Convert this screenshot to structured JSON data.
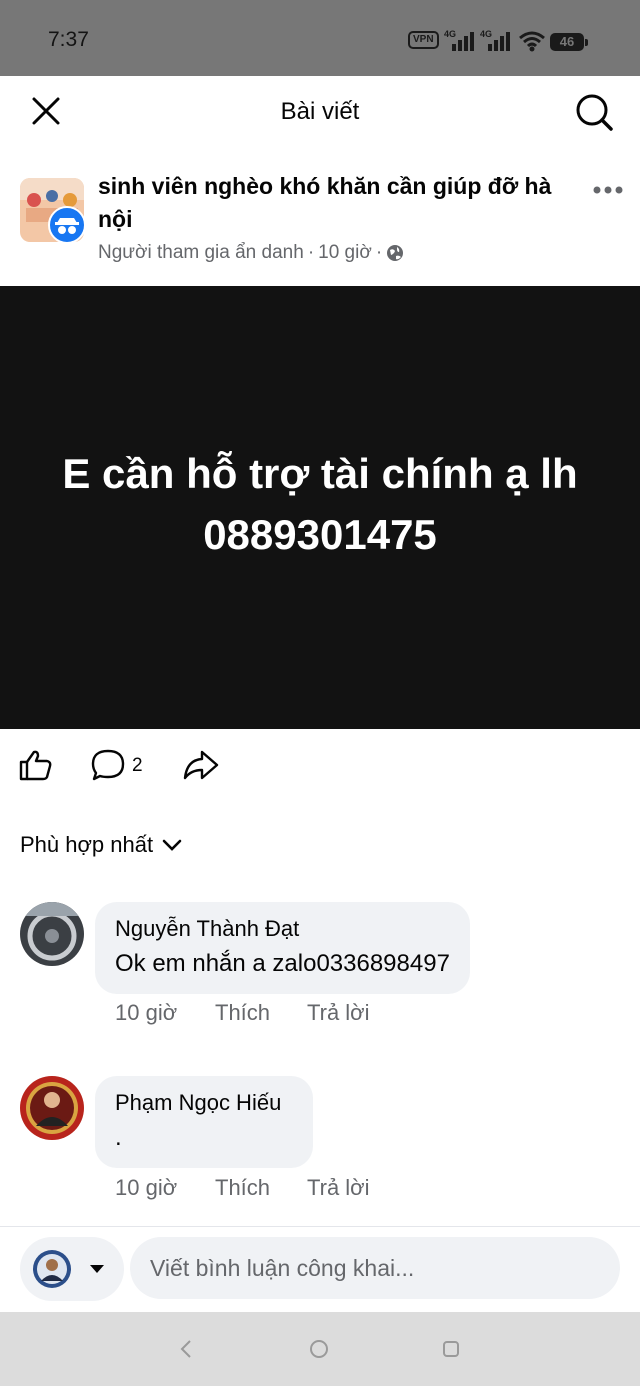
{
  "status_bar": {
    "time": "7:37",
    "vpn": "VPN",
    "network": "4G",
    "battery": "46"
  },
  "header": {
    "title": "Bài viết"
  },
  "post": {
    "group_name": "sinh viên nghèo khó khăn cần giúp đỡ hà nội",
    "author": "Người tham gia ẩn danh",
    "time": "10 giờ",
    "image_text_line1": "E cần hỗ trợ tài chính ạ lh",
    "image_text_line2": "0889301475",
    "comment_count": "2"
  },
  "comments_section": {
    "sort_label": "Phù hợp nhất",
    "comments": [
      {
        "name": "Nguyễn Thành Đạt",
        "text": "Ok em nhắn a zalo0336898497",
        "time": "10 giờ",
        "like": "Thích",
        "reply": "Trả lời"
      },
      {
        "name": "Phạm Ngọc Hiếu",
        "text": ".",
        "time": "10 giờ",
        "like": "Thích",
        "reply": "Trả lời"
      }
    ]
  },
  "composer": {
    "placeholder": "Viết bình luận công khai..."
  },
  "colors": {
    "status_bar_bg": "#777777",
    "post_image_bg": "#121212",
    "bubble_bg": "#f0f2f5",
    "secondary_text": "#65676b",
    "anon_badge": "#1877f2"
  },
  "icons": [
    "close-icon",
    "search-icon",
    "more-icon",
    "globe-icon",
    "like-icon",
    "comment-icon",
    "share-icon",
    "chevron-down-icon",
    "caret-down-icon",
    "back-icon",
    "home-icon",
    "recents-icon"
  ]
}
